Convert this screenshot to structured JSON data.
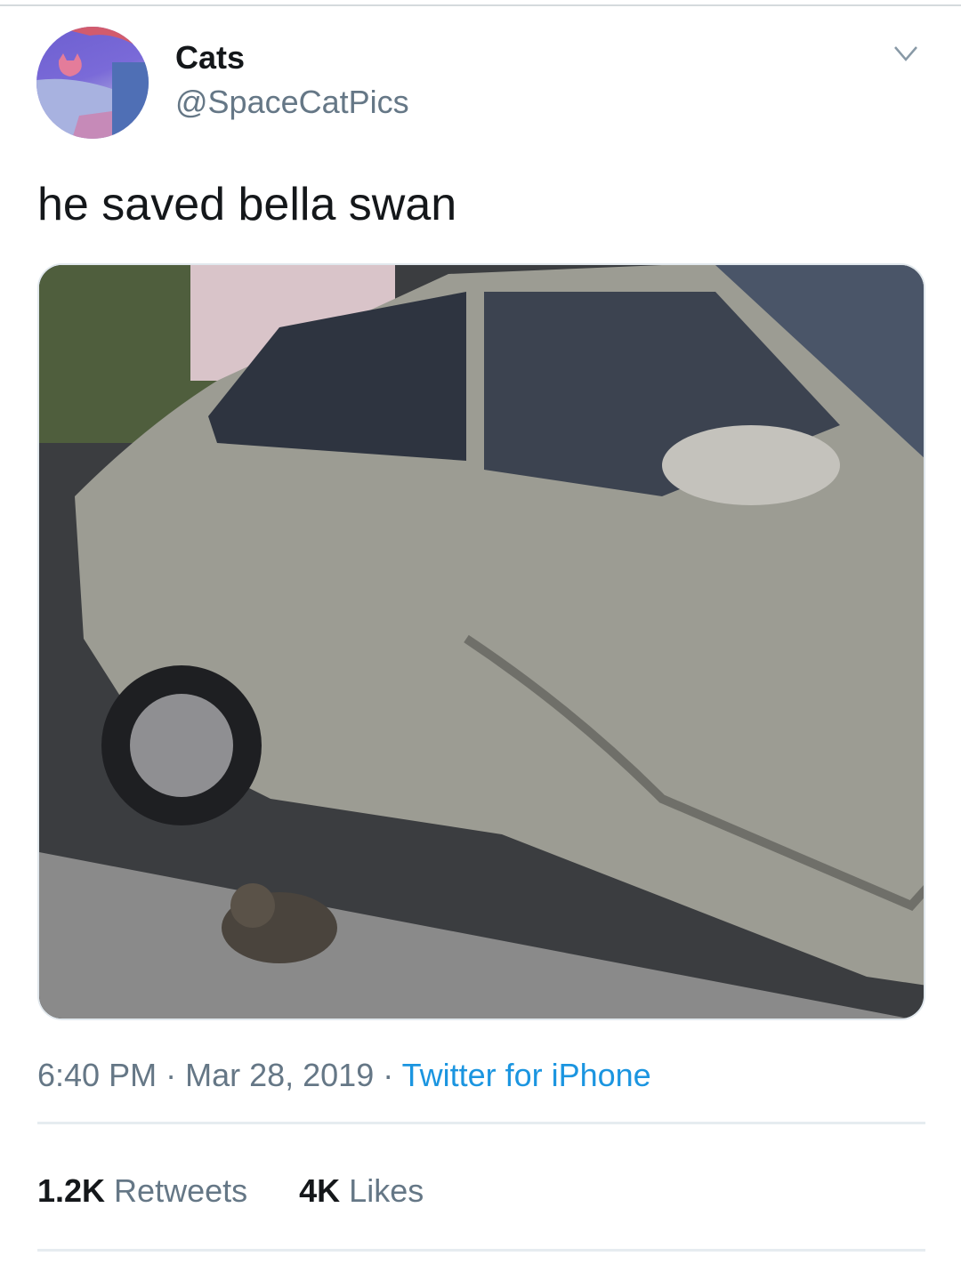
{
  "user": {
    "name": "Cats",
    "handle": "@SpaceCatPics"
  },
  "tweet": {
    "text": "he saved bella swan"
  },
  "meta": {
    "time": "6:40 PM",
    "sep1": " · ",
    "date": "Mar 28, 2019",
    "sep2": " · ",
    "source": "Twitter for iPhone"
  },
  "stats": {
    "retweets_count": "1.2K",
    "retweets_label": " Retweets",
    "likes_count": "4K",
    "likes_label": " Likes"
  },
  "colors": {
    "link": "#1b95e0",
    "secondary": "#657786",
    "primary": "#14171a"
  },
  "icons": {
    "menu": "chevron-down-icon"
  }
}
